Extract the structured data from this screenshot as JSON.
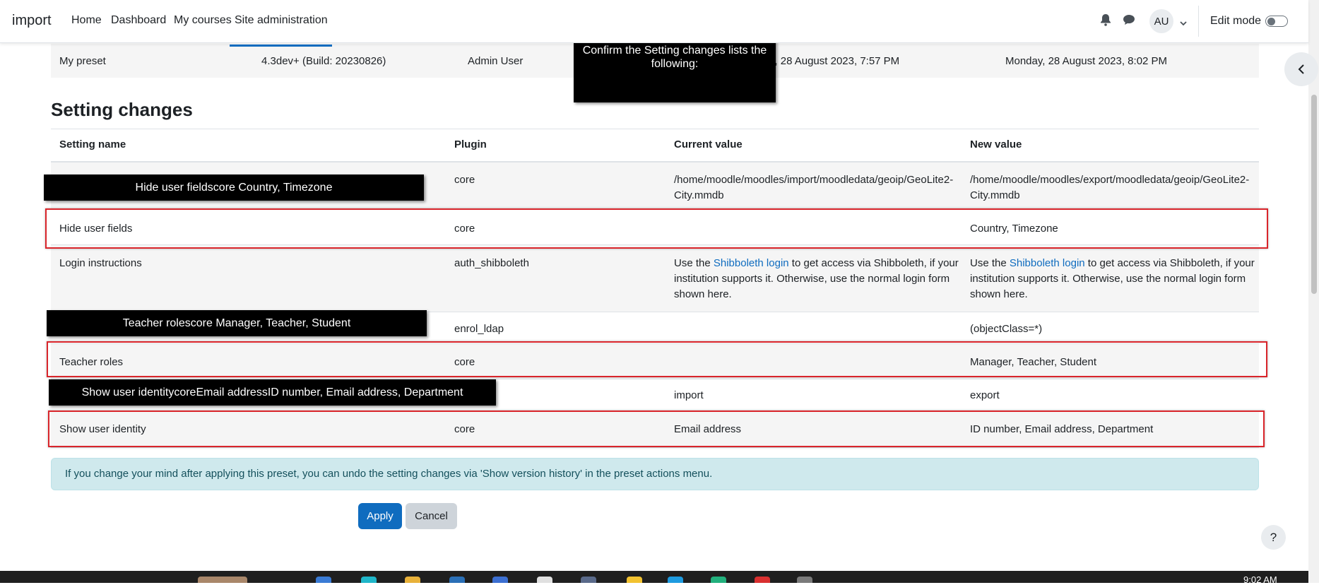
{
  "navbar": {
    "brand": "import",
    "links": [
      "Home",
      "Dashboard",
      "My courses",
      "Site administration"
    ],
    "avatar": "AU",
    "edit_mode": "Edit mode"
  },
  "preset_row": {
    "name": "My preset",
    "version": "4.3dev+ (Build: 20230826)",
    "author": "Admin User",
    "time_created": "y, 28 August 2023, 7:57 PM",
    "time_modified": "Monday, 28 August 2023, 8:02 PM"
  },
  "section_title": "Setting changes",
  "table": {
    "headers": [
      "Setting name",
      "Plugin",
      "Current value",
      "New value"
    ],
    "rows": [
      {
        "name": "",
        "plugin": "core",
        "current": "/home/moodle/moodles/import/moodledata/geoip/GeoLite2-City.mmdb",
        "new": "/home/moodle/moodles/export/moodledata/geoip/GeoLite2-City.mmdb"
      },
      {
        "name": "Hide user fields",
        "plugin": "core",
        "current": "",
        "new": "Country, Timezone"
      },
      {
        "name": "Login instructions",
        "plugin": "auth_shibboleth",
        "current_pre": "Use the ",
        "current_link": "Shibboleth login",
        "current_post": " to get access via Shibboleth, if your institution supports it. Otherwise, use the normal login form shown here.",
        "new_pre": "Use the ",
        "new_link": "Shibboleth login",
        "new_post": " to get access via Shibboleth, if your institution supports it. Otherwise, use the normal login form shown here."
      },
      {
        "name": "",
        "plugin": "enrol_ldap",
        "current": "",
        "new": "(objectClass=*)"
      },
      {
        "name": "Teacher roles",
        "plugin": "core",
        "current": "",
        "new": "Manager, Teacher, Student"
      },
      {
        "name": "",
        "plugin": "",
        "current": "import",
        "new": "export"
      },
      {
        "name": "Show user identity",
        "plugin": "core",
        "current": "Email address",
        "new": "ID number, Email address, Department"
      }
    ]
  },
  "tooltips": {
    "confirm": "Confirm the Setting changes lists the following:",
    "hide_fields": "Hide user fieldscore Country, Timezone",
    "teacher_roles": "Teacher rolescore Manager, Teacher, Student",
    "show_identity": "Show user identitycoreEmail addressID number, Email address, Department"
  },
  "alert": "If you change your mind after applying this preset, you can undo the setting changes via 'Show version history' in the preset actions menu.",
  "buttons": {
    "apply": "Apply",
    "cancel": "Cancel",
    "help": "?"
  },
  "taskbar": {
    "clock": "9:02 AM"
  },
  "colors": {
    "primary": "#0f6cbf",
    "highlight": "#d9252b",
    "alert_bg": "#cfe9ed"
  },
  "icons": [
    "bell-icon",
    "chat-icon",
    "chevron-down-icon",
    "chevron-left-icon",
    "question-icon"
  ]
}
